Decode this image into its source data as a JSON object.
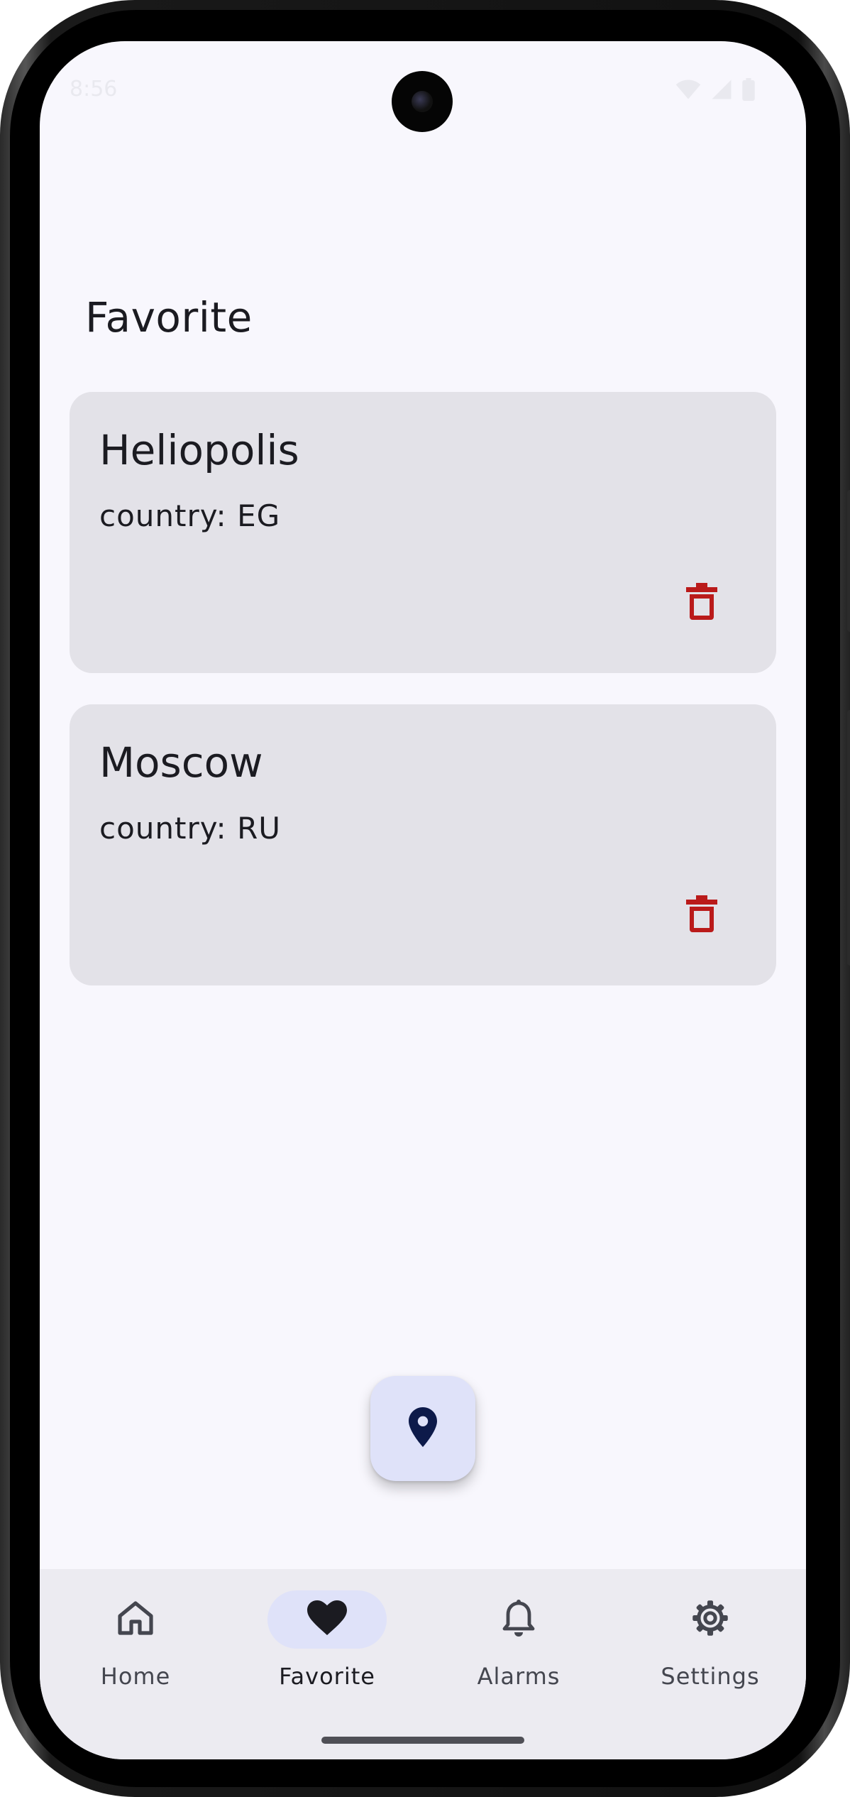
{
  "status_bar": {
    "time": "8:56",
    "icons": [
      "wifi-icon",
      "cellular-icon",
      "battery-icon"
    ]
  },
  "page": {
    "title": "Favorite"
  },
  "favorites": [
    {
      "city": "Heliopolis",
      "country": "country: EG",
      "delete_icon": "trash-icon"
    },
    {
      "city": "Moscow",
      "country": "country: RU",
      "delete_icon": "trash-icon"
    }
  ],
  "fab": {
    "icon": "location-pin-icon"
  },
  "bottom_nav": {
    "items": [
      {
        "label": "Home",
        "icon": "home-icon",
        "active": false
      },
      {
        "label": "Favorite",
        "icon": "heart-icon",
        "active": true
      },
      {
        "label": "Alarms",
        "icon": "bell-icon",
        "active": false
      },
      {
        "label": "Settings",
        "icon": "gear-icon",
        "active": false
      }
    ]
  },
  "colors": {
    "background": "#f8f7fd",
    "card": "#e3e2e8",
    "delete": "#ba1a1a",
    "active_pill": "#dfe2f9",
    "nav_bar": "#ecebf1",
    "fab_icon": "#0d1a4a"
  }
}
